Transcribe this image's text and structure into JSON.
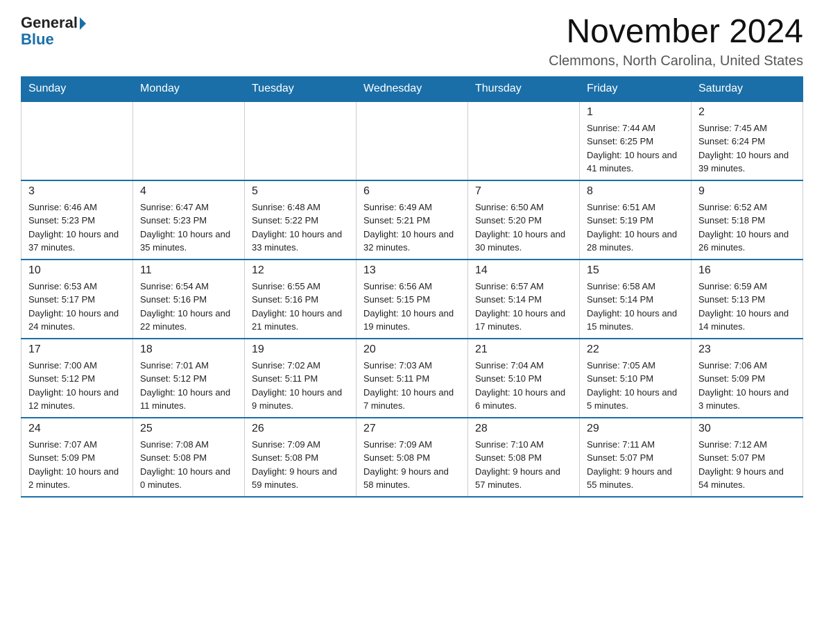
{
  "header": {
    "logo_general": "General",
    "logo_blue": "Blue",
    "main_title": "November 2024",
    "subtitle": "Clemmons, North Carolina, United States"
  },
  "days_of_week": [
    "Sunday",
    "Monday",
    "Tuesday",
    "Wednesday",
    "Thursday",
    "Friday",
    "Saturday"
  ],
  "weeks": [
    [
      {
        "day": "",
        "info": ""
      },
      {
        "day": "",
        "info": ""
      },
      {
        "day": "",
        "info": ""
      },
      {
        "day": "",
        "info": ""
      },
      {
        "day": "",
        "info": ""
      },
      {
        "day": "1",
        "info": "Sunrise: 7:44 AM\nSunset: 6:25 PM\nDaylight: 10 hours and 41 minutes."
      },
      {
        "day": "2",
        "info": "Sunrise: 7:45 AM\nSunset: 6:24 PM\nDaylight: 10 hours and 39 minutes."
      }
    ],
    [
      {
        "day": "3",
        "info": "Sunrise: 6:46 AM\nSunset: 5:23 PM\nDaylight: 10 hours and 37 minutes."
      },
      {
        "day": "4",
        "info": "Sunrise: 6:47 AM\nSunset: 5:23 PM\nDaylight: 10 hours and 35 minutes."
      },
      {
        "day": "5",
        "info": "Sunrise: 6:48 AM\nSunset: 5:22 PM\nDaylight: 10 hours and 33 minutes."
      },
      {
        "day": "6",
        "info": "Sunrise: 6:49 AM\nSunset: 5:21 PM\nDaylight: 10 hours and 32 minutes."
      },
      {
        "day": "7",
        "info": "Sunrise: 6:50 AM\nSunset: 5:20 PM\nDaylight: 10 hours and 30 minutes."
      },
      {
        "day": "8",
        "info": "Sunrise: 6:51 AM\nSunset: 5:19 PM\nDaylight: 10 hours and 28 minutes."
      },
      {
        "day": "9",
        "info": "Sunrise: 6:52 AM\nSunset: 5:18 PM\nDaylight: 10 hours and 26 minutes."
      }
    ],
    [
      {
        "day": "10",
        "info": "Sunrise: 6:53 AM\nSunset: 5:17 PM\nDaylight: 10 hours and 24 minutes."
      },
      {
        "day": "11",
        "info": "Sunrise: 6:54 AM\nSunset: 5:16 PM\nDaylight: 10 hours and 22 minutes."
      },
      {
        "day": "12",
        "info": "Sunrise: 6:55 AM\nSunset: 5:16 PM\nDaylight: 10 hours and 21 minutes."
      },
      {
        "day": "13",
        "info": "Sunrise: 6:56 AM\nSunset: 5:15 PM\nDaylight: 10 hours and 19 minutes."
      },
      {
        "day": "14",
        "info": "Sunrise: 6:57 AM\nSunset: 5:14 PM\nDaylight: 10 hours and 17 minutes."
      },
      {
        "day": "15",
        "info": "Sunrise: 6:58 AM\nSunset: 5:14 PM\nDaylight: 10 hours and 15 minutes."
      },
      {
        "day": "16",
        "info": "Sunrise: 6:59 AM\nSunset: 5:13 PM\nDaylight: 10 hours and 14 minutes."
      }
    ],
    [
      {
        "day": "17",
        "info": "Sunrise: 7:00 AM\nSunset: 5:12 PM\nDaylight: 10 hours and 12 minutes."
      },
      {
        "day": "18",
        "info": "Sunrise: 7:01 AM\nSunset: 5:12 PM\nDaylight: 10 hours and 11 minutes."
      },
      {
        "day": "19",
        "info": "Sunrise: 7:02 AM\nSunset: 5:11 PM\nDaylight: 10 hours and 9 minutes."
      },
      {
        "day": "20",
        "info": "Sunrise: 7:03 AM\nSunset: 5:11 PM\nDaylight: 10 hours and 7 minutes."
      },
      {
        "day": "21",
        "info": "Sunrise: 7:04 AM\nSunset: 5:10 PM\nDaylight: 10 hours and 6 minutes."
      },
      {
        "day": "22",
        "info": "Sunrise: 7:05 AM\nSunset: 5:10 PM\nDaylight: 10 hours and 5 minutes."
      },
      {
        "day": "23",
        "info": "Sunrise: 7:06 AM\nSunset: 5:09 PM\nDaylight: 10 hours and 3 minutes."
      }
    ],
    [
      {
        "day": "24",
        "info": "Sunrise: 7:07 AM\nSunset: 5:09 PM\nDaylight: 10 hours and 2 minutes."
      },
      {
        "day": "25",
        "info": "Sunrise: 7:08 AM\nSunset: 5:08 PM\nDaylight: 10 hours and 0 minutes."
      },
      {
        "day": "26",
        "info": "Sunrise: 7:09 AM\nSunset: 5:08 PM\nDaylight: 9 hours and 59 minutes."
      },
      {
        "day": "27",
        "info": "Sunrise: 7:09 AM\nSunset: 5:08 PM\nDaylight: 9 hours and 58 minutes."
      },
      {
        "day": "28",
        "info": "Sunrise: 7:10 AM\nSunset: 5:08 PM\nDaylight: 9 hours and 57 minutes."
      },
      {
        "day": "29",
        "info": "Sunrise: 7:11 AM\nSunset: 5:07 PM\nDaylight: 9 hours and 55 minutes."
      },
      {
        "day": "30",
        "info": "Sunrise: 7:12 AM\nSunset: 5:07 PM\nDaylight: 9 hours and 54 minutes."
      }
    ]
  ]
}
